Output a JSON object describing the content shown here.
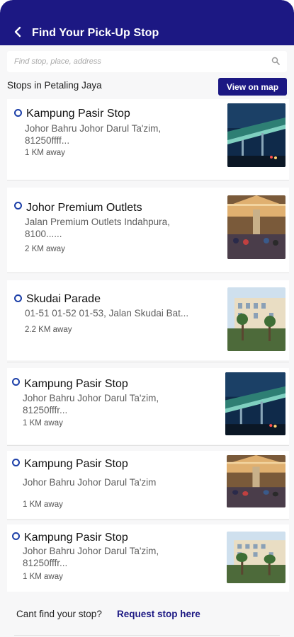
{
  "header": {
    "title": "Find Your Pick-Up Stop",
    "back_icon": "chevron-left-icon"
  },
  "search": {
    "placeholder": "Find stop, place, address",
    "icon": "search-icon"
  },
  "section": {
    "title": "Stops in Petaling Jaya",
    "map_button": "View on map"
  },
  "stops": [
    {
      "name": "Kampung Pasir Stop",
      "address_line1": "Johor Bahru Johor Darul Ta'zim,",
      "address_line2": "81250ffff...",
      "distance": "1 KM away",
      "image": "station-photo"
    },
    {
      "name": "Johor Premium Outlets",
      "address_line1": "Jalan Premium Outlets Indahpura,",
      "address_line2": "8100......",
      "distance": "2 KM away",
      "image": "outlet-photo"
    },
    {
      "name": "Skudai Parade",
      "address_line1": "01-51 01-52 01-53, Jalan Skudai Bat...",
      "address_line2": "",
      "distance": "2.2 KM away",
      "image": "mall-photo"
    },
    {
      "name": "Kampung Pasir Stop",
      "address_line1": "Johor Bahru Johor Darul Ta'zim,",
      "address_line2": "81250fffr...",
      "distance": "1 KM away",
      "image": "station-photo"
    },
    {
      "name": "Kampung Pasir Stop",
      "address_line1": "Johor Bahru Johor Darul Ta'zim",
      "address_line2": "",
      "distance": "1 KM away",
      "image": "outlet-photo"
    },
    {
      "name": "Kampung Pasir Stop",
      "address_line1": "Johor Bahru Johor Darul Ta'zim,",
      "address_line2": "81250fffr...",
      "distance": "1 KM away",
      "image": "mall-photo"
    }
  ],
  "footer": {
    "prompt": "Cant find your stop?",
    "link": "Request stop here"
  },
  "colors": {
    "primary": "#1c1883",
    "bullet": "#1c3fa8"
  }
}
